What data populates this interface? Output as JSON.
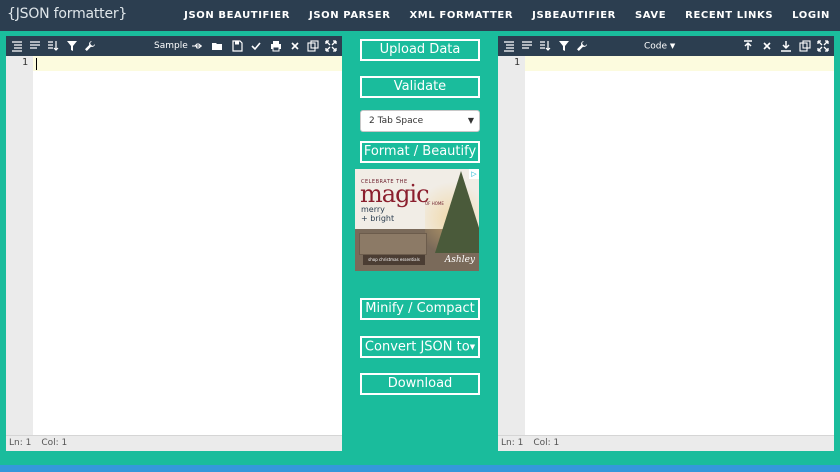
{
  "header": {
    "logo": "{JSON formatter}",
    "nav": [
      "JSON BEAUTIFIER",
      "JSON PARSER",
      "XML FORMATTER",
      "JSBEAUTIFIER",
      "SAVE",
      "RECENT LINKS",
      "LOGIN"
    ]
  },
  "left_editor": {
    "sample_label": "Sample",
    "line_number": "1",
    "status_ln": "Ln: 1",
    "status_col": "Col: 1"
  },
  "right_editor": {
    "code_label": "Code",
    "line_number": "1",
    "status_ln": "Ln: 1",
    "status_col": "Col: 1"
  },
  "controls": {
    "upload": "Upload Data",
    "validate": "Validate",
    "tab_select": "2 Tab Space",
    "format": "Format / Beautify",
    "minify": "Minify / Compact",
    "convert": "Convert JSON to",
    "download": "Download"
  },
  "ad": {
    "headline_top": "CELEBRATE THE",
    "headline": "magic",
    "headline_sub": "OF HOME",
    "line1": "merry",
    "line2": "+ bright",
    "cta": "shop christmas essentials",
    "brand": "Ashley"
  }
}
